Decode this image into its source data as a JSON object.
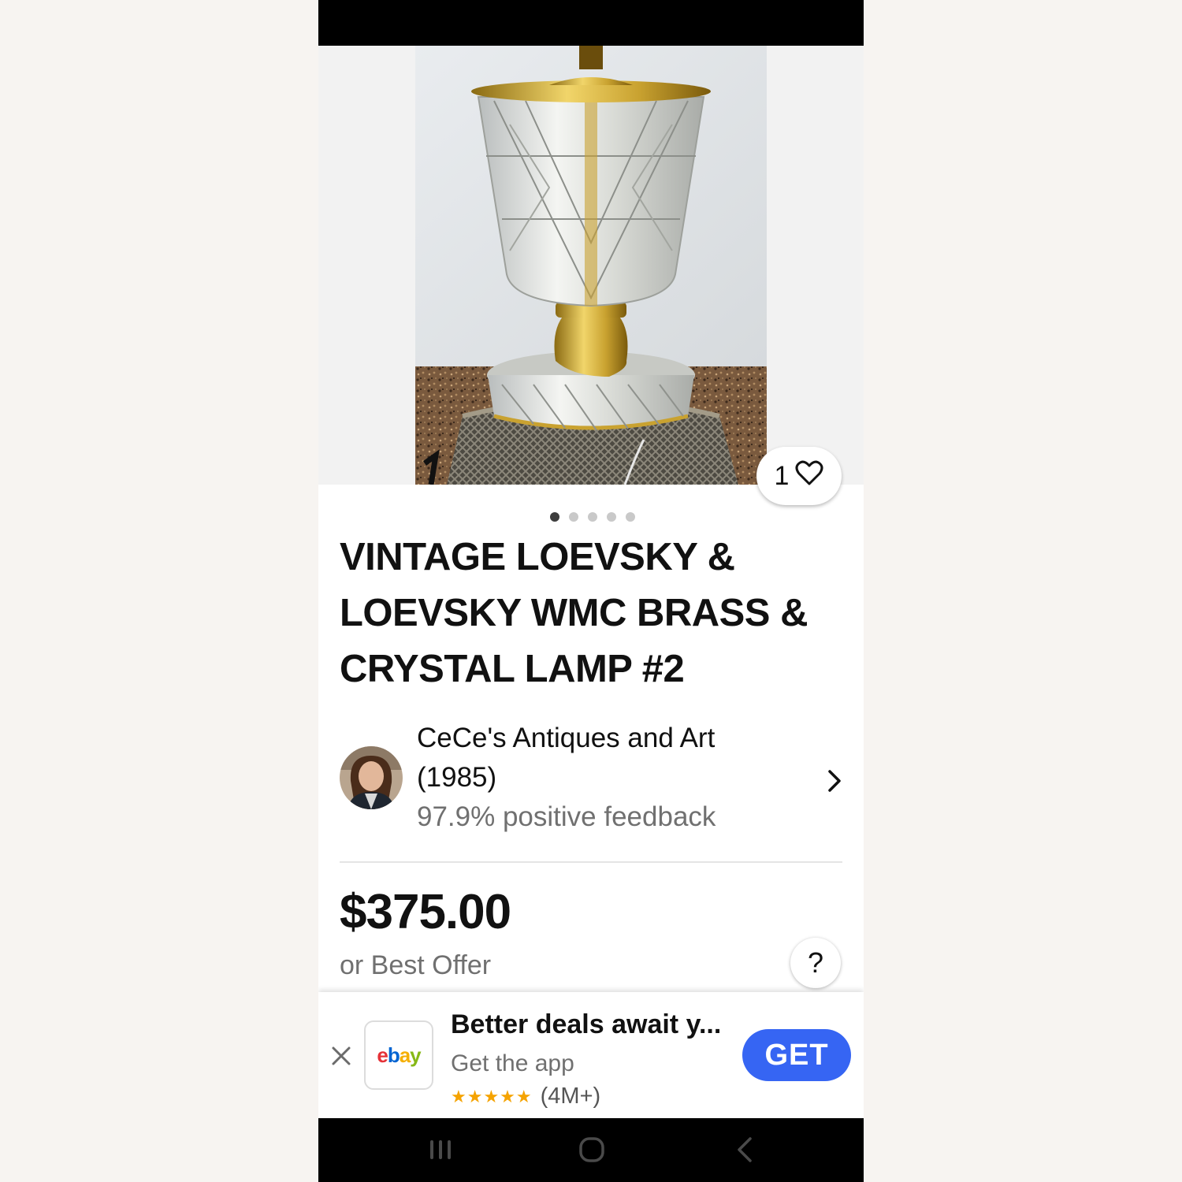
{
  "listing": {
    "like_count": "1",
    "title": "VINTAGE LOEVSKY & LOEVSKY WMC BRASS & CRYSTAL LAMP #2",
    "image_count": 5,
    "active_image_index": 0
  },
  "seller": {
    "name": "CeCe's Antiques and Art",
    "score": "(1985)",
    "feedback": "97.9% positive feedback"
  },
  "pricing": {
    "price": "$375.00",
    "best_offer": "or Best Offer",
    "help_label": "?"
  },
  "app_banner": {
    "logo_letters": [
      "e",
      "b",
      "a",
      "y"
    ],
    "logo_colors": [
      "#e53238",
      "#0064d2",
      "#f5af02",
      "#86b817"
    ],
    "headline": "Better deals await y...",
    "subtitle": "Get the app",
    "stars": "★★★★★",
    "rating_count": "(4M+)",
    "get_label": "GET",
    "accent_color": "#3665f3"
  },
  "icons": [
    "heart-icon",
    "chevron-right-icon",
    "close-icon",
    "recent-apps-icon",
    "home-icon",
    "back-icon"
  ]
}
